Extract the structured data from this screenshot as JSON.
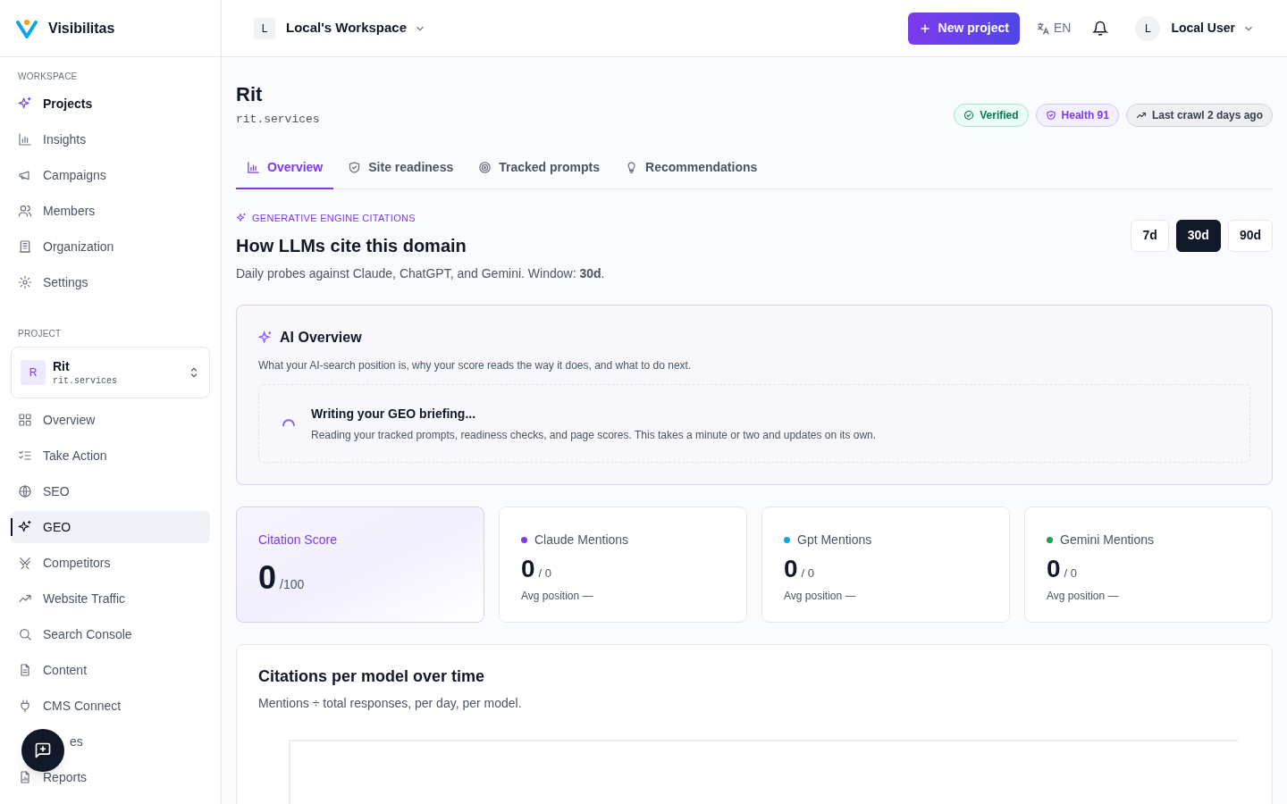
{
  "brand": {
    "name": "Visibilitas"
  },
  "workspace_switcher": {
    "initial": "L",
    "name": "Local's Workspace"
  },
  "header": {
    "new_project": "New project",
    "language": "EN",
    "user": {
      "initial": "L",
      "name": "Local User"
    }
  },
  "sidebar": {
    "sections": [
      {
        "title": "WORKSPACE",
        "items": [
          {
            "label": "Projects",
            "selected": true
          },
          {
            "label": "Insights",
            "selected": false
          },
          {
            "label": "Campaigns",
            "selected": false
          },
          {
            "label": "Members",
            "selected": false
          },
          {
            "label": "Organization",
            "selected": false
          },
          {
            "label": "Settings",
            "selected": false
          }
        ]
      },
      {
        "title": "PROJECT",
        "project": {
          "initial": "R",
          "name": "Rit",
          "domain": "rit.services"
        },
        "items": [
          {
            "label": "Overview",
            "selected": false
          },
          {
            "label": "Take Action",
            "selected": false
          },
          {
            "label": "SEO",
            "selected": false
          },
          {
            "label": "GEO",
            "selected": true
          },
          {
            "label": "Competitors",
            "selected": false
          },
          {
            "label": "Website Traffic",
            "selected": false
          },
          {
            "label": "Search Console",
            "selected": false
          },
          {
            "label": "Content",
            "selected": false
          },
          {
            "label": "CMS Connect",
            "selected": false
          },
          {
            "label": "es",
            "selected": false
          },
          {
            "label": "Reports",
            "selected": false
          }
        ]
      }
    ]
  },
  "project": {
    "name": "Rit",
    "domain": "rit.services",
    "badges": [
      {
        "label": "Verified",
        "kind": "verified"
      },
      {
        "label": "Health 91",
        "kind": "health"
      },
      {
        "label": "Last crawl 2 days ago",
        "kind": "crawl"
      }
    ]
  },
  "tabs": [
    {
      "label": "Overview",
      "selected": true
    },
    {
      "label": "Site readiness",
      "selected": false
    },
    {
      "label": "Tracked prompts",
      "selected": false
    },
    {
      "label": "Recommendations",
      "selected": false
    }
  ],
  "section": {
    "eyebrow": "GENERATIVE ENGINE CITATIONS",
    "title": "How LLMs cite this domain",
    "subtitle": "Daily probes against Claude, ChatGPT, and Gemini. Window: **30d**.",
    "ranges": [
      {
        "label": "7d",
        "selected": false
      },
      {
        "label": "30d",
        "selected": true
      },
      {
        "label": "90d",
        "selected": false
      }
    ]
  },
  "ai_overview": {
    "title": "AI Overview",
    "subtitle": "What your AI-search position is, why your score reads the way it does, and what to do next.",
    "status": {
      "title": "Writing your GEO briefing...",
      "text": "Reading your tracked prompts, readiness checks, and page scores. This takes a minute or two and updates on its own."
    }
  },
  "metrics": [
    {
      "kind": "score",
      "label": "Citation Score",
      "value": "0",
      "suffix": "/100"
    },
    {
      "kind": "model",
      "label": "Claude Mentions",
      "color": "#7c3aed",
      "value": "0",
      "suffix": "/ 0",
      "note": "Avg position —"
    },
    {
      "kind": "model",
      "label": "Gpt Mentions",
      "color": "#0ea5e9",
      "value": "0",
      "suffix": "/ 0",
      "note": "Avg position —"
    },
    {
      "kind": "model",
      "label": "Gemini Mentions",
      "color": "#16a34a",
      "value": "0",
      "suffix": "/ 0",
      "note": "Avg position —"
    }
  ],
  "chart_card": {
    "title": "Citations per model over time",
    "subtitle": "Mentions ÷ total responses, per day, per model."
  }
}
